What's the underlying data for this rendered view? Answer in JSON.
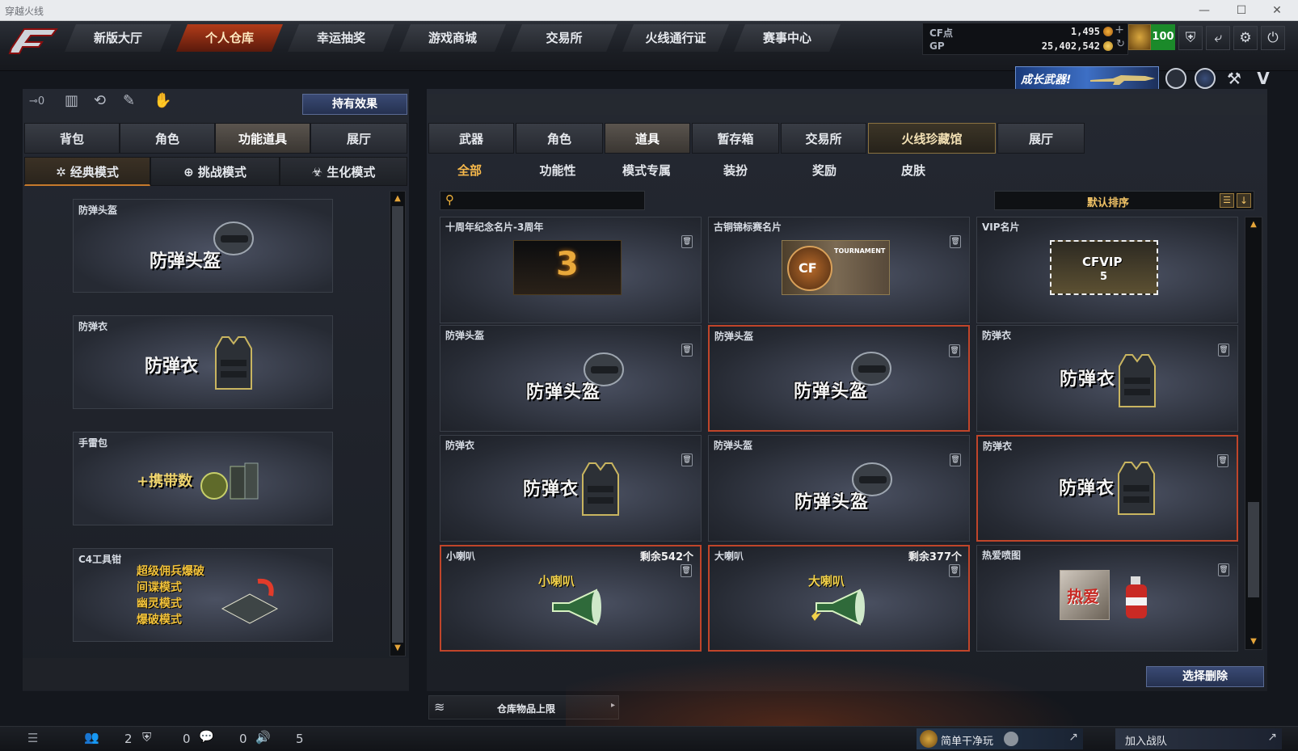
{
  "window": {
    "title": "穿越火线"
  },
  "nav": {
    "tabs": [
      {
        "label": "新版大厅"
      },
      {
        "label": "个人仓库"
      },
      {
        "label": "幸运抽奖"
      },
      {
        "label": "游戏商城"
      },
      {
        "label": "交易所"
      },
      {
        "label": "火线通行证"
      },
      {
        "label": "赛事中心"
      }
    ],
    "active_index": 1
  },
  "currency": {
    "cf_label": "CF点",
    "cf_value": "1,495",
    "gp_label": "GP",
    "gp_value": "25,402,542",
    "level": "100"
  },
  "banner": {
    "text": "成长武器!"
  },
  "left": {
    "effects_button": "持有效果",
    "key_count": "0",
    "tabs": [
      {
        "label": "背包"
      },
      {
        "label": "角色"
      },
      {
        "label": "功能道具"
      },
      {
        "label": "展厅"
      }
    ],
    "modes": [
      {
        "label": "经典模式"
      },
      {
        "label": "挑战模式"
      },
      {
        "label": "生化模式"
      }
    ],
    "items": [
      {
        "title": "防弹头盔",
        "art_text": "防弹头盔"
      },
      {
        "title": "防弹衣",
        "art_text": "防弹衣"
      },
      {
        "title": "手雷包",
        "art_text": "+携带数"
      },
      {
        "title": "C4工具钳",
        "art_lines": [
          "超级佣兵爆破",
          "间谍模式",
          "幽灵模式",
          "爆破模式"
        ]
      }
    ]
  },
  "right": {
    "tabs": [
      {
        "label": "武器"
      },
      {
        "label": "角色"
      },
      {
        "label": "道具"
      },
      {
        "label": "暂存箱"
      },
      {
        "label": "交易所"
      },
      {
        "label": "火线珍藏馆"
      },
      {
        "label": "展厅"
      }
    ],
    "subcats": [
      {
        "label": "全部"
      },
      {
        "label": "功能性"
      },
      {
        "label": "模式专属"
      },
      {
        "label": "装扮"
      },
      {
        "label": "奖励"
      },
      {
        "label": "皮肤"
      }
    ],
    "search_placeholder": "",
    "sort_label": "默认排序",
    "items": [
      {
        "title": "十周年纪念名片-3周年",
        "art": "card3"
      },
      {
        "title": "古铜锦标赛名片",
        "art": "tournament",
        "art_text": "TOURNAMENT",
        "badge": "CF"
      },
      {
        "title": "VIP名片",
        "art": "vip",
        "art_text": "CFVIP",
        "art_sub": "5"
      },
      {
        "title": "防弹头盔",
        "art_text": "防弹头盔"
      },
      {
        "title": "防弹头盔",
        "art_text": "防弹头盔",
        "selected": true
      },
      {
        "title": "防弹衣",
        "art_text": "防弹衣"
      },
      {
        "title": "防弹衣",
        "art_text": "防弹衣"
      },
      {
        "title": "防弹头盔",
        "art_text": "防弹头盔"
      },
      {
        "title": "防弹衣",
        "art_text": "防弹衣",
        "selected": true
      },
      {
        "title": "小喇叭",
        "remain": "剩余542个",
        "art_text": "小喇叭",
        "selected": true
      },
      {
        "title": "大喇叭",
        "remain": "剩余377个",
        "art_text": "大喇叭",
        "selected": true
      },
      {
        "title": "热爱喷图",
        "art_text": "热爱"
      }
    ],
    "delete_button": "选择删除",
    "storage_limit": "仓库物品上限"
  },
  "status": {
    "count1": "2",
    "count2": "0",
    "count3": "0",
    "count4": "5",
    "rest_label": "简单干净玩",
    "join_label": "加入战队"
  }
}
